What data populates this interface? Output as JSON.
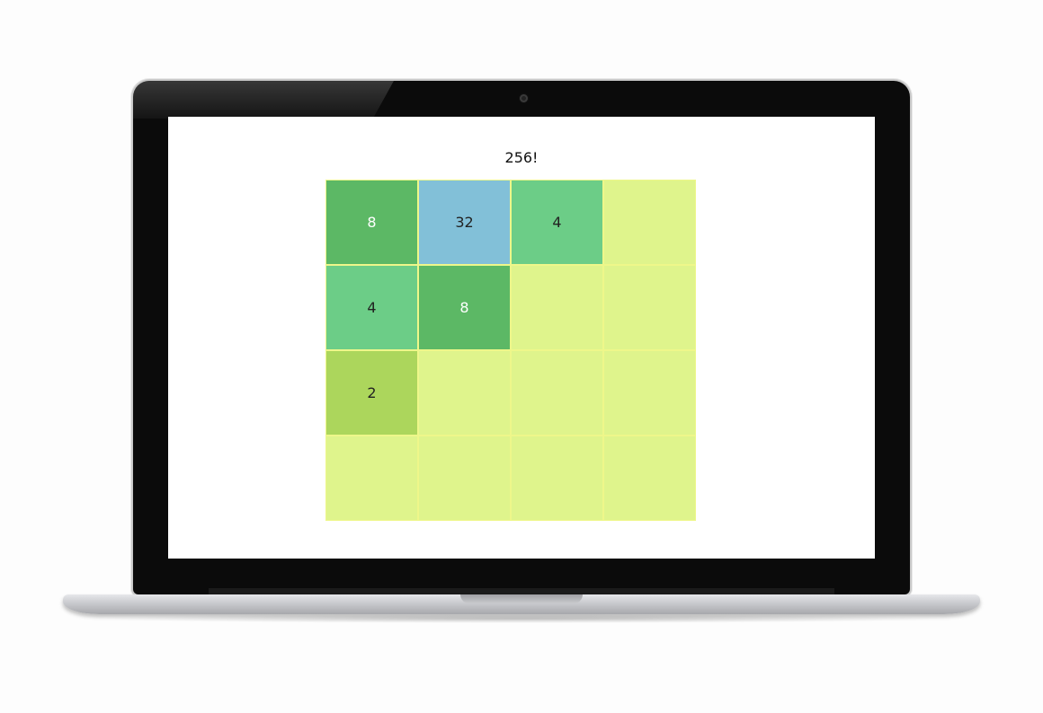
{
  "game": {
    "score_text": "256!",
    "board": [
      [
        "8",
        "32",
        "4",
        ""
      ],
      [
        "4",
        "8",
        "",
        ""
      ],
      [
        "2",
        "",
        "",
        ""
      ],
      [
        "",
        "",
        "",
        ""
      ]
    ]
  },
  "colors": {
    "empty": "#dff48c",
    "2": "#acd65c",
    "4": "#6ccd87",
    "8": "#5cb865",
    "32": "#82c0d8",
    "light_text": "#ffffff",
    "dark_text": "#222222"
  }
}
